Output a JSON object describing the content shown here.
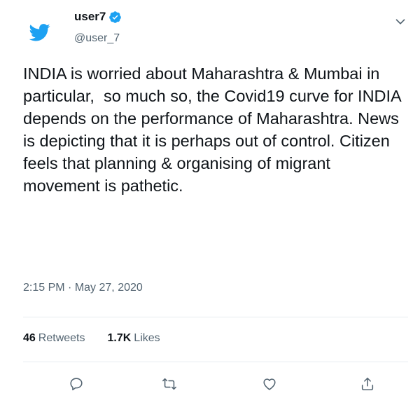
{
  "user": {
    "display_name": "user7",
    "handle": "@user_7",
    "verified_icon": "verified-badge-icon",
    "avatar_icon": "twitter-bird-icon"
  },
  "tweet": {
    "text": "INDIA is worried about Maharashtra & Mumbai in particular,  so much so, the Covid19 curve for INDIA depends on the performance of Maharashtra. News is depicting that it is perhaps out of control. Citizen feels that planning & organising of migrant movement is pathetic.",
    "time": "2:15 PM",
    "separator": "·",
    "date": "May 27, 2020"
  },
  "stats": {
    "retweets_count": "46",
    "retweets_label": "Retweets",
    "likes_count": "1.7K",
    "likes_label": "Likes"
  },
  "actions": [
    "reply-icon",
    "retweet-icon",
    "like-icon",
    "share-icon"
  ],
  "colors": {
    "brand": "#1da1f2",
    "text": "#0f1419",
    "secondary": "#536471",
    "divider": "#e6ecf0"
  }
}
